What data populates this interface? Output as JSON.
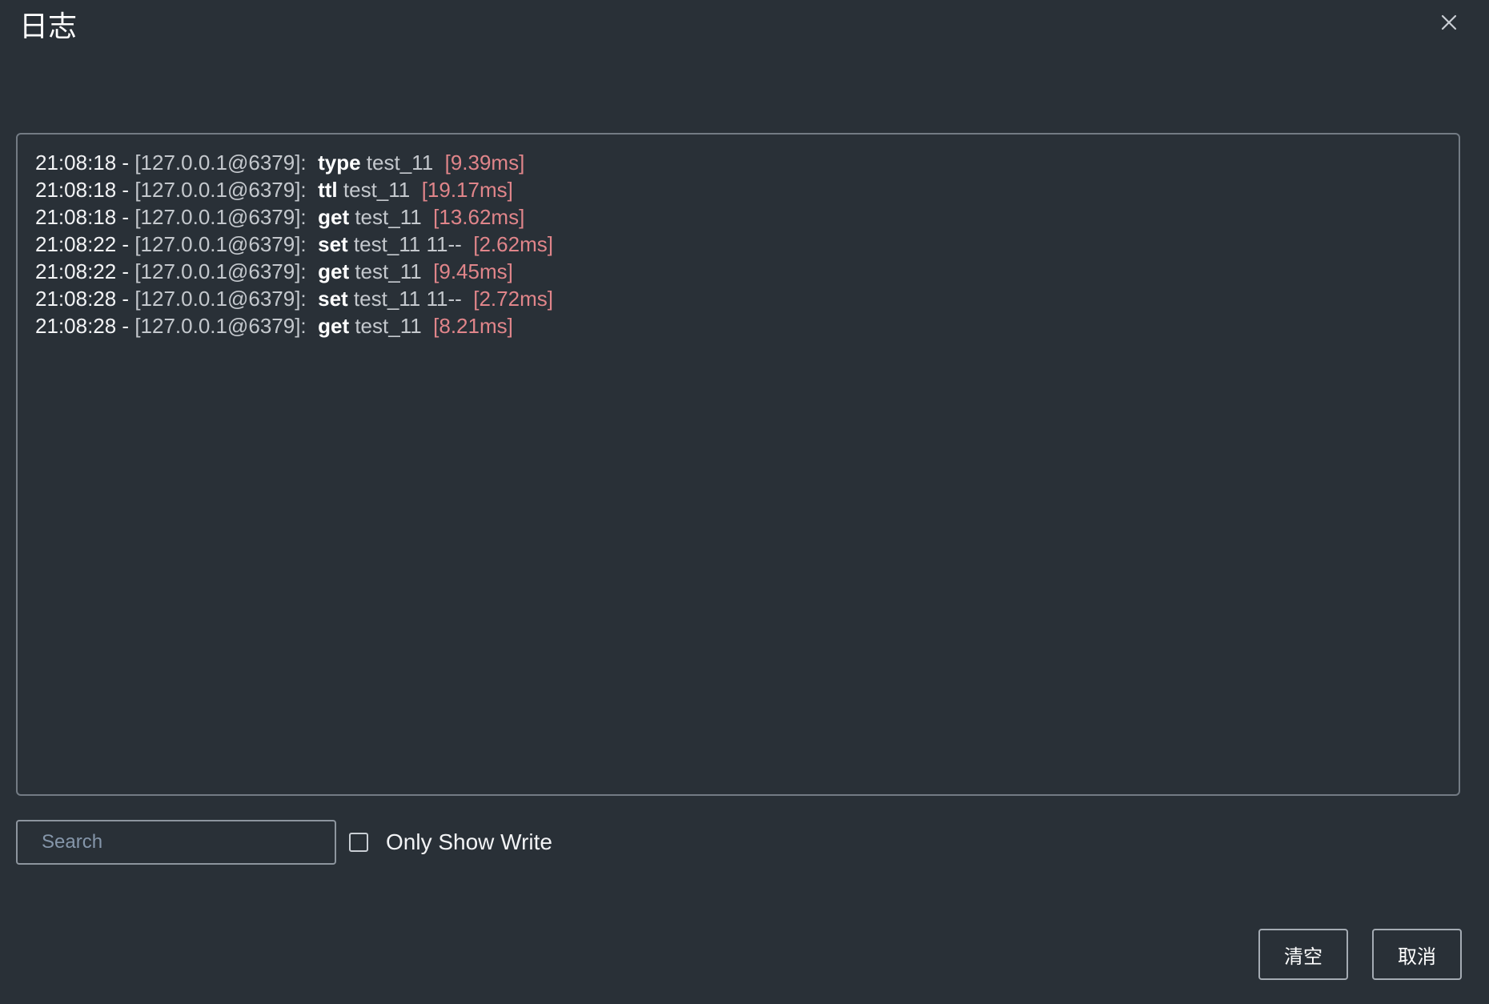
{
  "dialog": {
    "title": "日志"
  },
  "log": {
    "entries": [
      {
        "time": "21:08:18 - ",
        "host": "[127.0.0.1@6379]:  ",
        "cmd": "type",
        "args": " test_11  ",
        "cost": "[9.39ms]"
      },
      {
        "time": "21:08:18 - ",
        "host": "[127.0.0.1@6379]:  ",
        "cmd": "ttl",
        "args": " test_11  ",
        "cost": "[19.17ms]"
      },
      {
        "time": "21:08:18 - ",
        "host": "[127.0.0.1@6379]:  ",
        "cmd": "get",
        "args": " test_11  ",
        "cost": "[13.62ms]"
      },
      {
        "time": "21:08:22 - ",
        "host": "[127.0.0.1@6379]:  ",
        "cmd": "set",
        "args": " test_11 11--  ",
        "cost": "[2.62ms]"
      },
      {
        "time": "21:08:22 - ",
        "host": "[127.0.0.1@6379]:  ",
        "cmd": "get",
        "args": " test_11  ",
        "cost": "[9.45ms]"
      },
      {
        "time": "21:08:28 - ",
        "host": "[127.0.0.1@6379]:  ",
        "cmd": "set",
        "args": " test_11 11--  ",
        "cost": "[2.72ms]"
      },
      {
        "time": "21:08:28 - ",
        "host": "[127.0.0.1@6379]:  ",
        "cmd": "get",
        "args": " test_11  ",
        "cost": "[8.21ms]"
      }
    ]
  },
  "filters": {
    "search_placeholder": "Search",
    "search_value": "",
    "only_show_write_label": "Only Show Write",
    "only_show_write_checked": false
  },
  "footer": {
    "clear_label": "清空",
    "cancel_label": "取消"
  },
  "icons": {
    "close": "close-icon"
  },
  "colors": {
    "background": "#293037",
    "duration": "#e0858a",
    "border": "#737b84"
  }
}
